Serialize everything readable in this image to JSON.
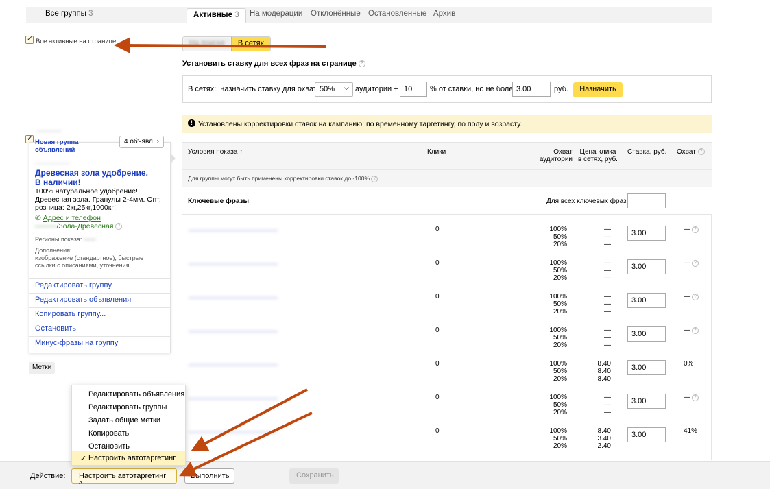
{
  "tabs": {
    "all_groups": "Все группы",
    "all_groups_count": "3",
    "active": "Активные",
    "active_count": "3",
    "moderation": "На модерации",
    "rejected": "Отклонённые",
    "stopped": "Остановленные",
    "archive": "Архив"
  },
  "select_all_label": "Все активные на странице",
  "network_toggle": {
    "search": "На поиске",
    "networks": "В сетях"
  },
  "bid_panel": {
    "title": "Установить ставку для всех фраз на странице",
    "prefix": "В сетях:  назначить ставку для охвата",
    "coverage": "50%",
    "audience_label": "аудитории +",
    "plus_value": "10",
    "limit_label": "% от ставки, но не более",
    "max_value": "3.00",
    "currency": "руб.",
    "assign_button": "Назначить"
  },
  "warning_text": "Установлены корректировки ставок на кампанию: по временному таргетингу, по полу и возрасту.",
  "group_card": {
    "title_line1": "Новая группа",
    "title_line2": "объявлений",
    "ads_count_button": "4 объявл.",
    "ad_title_line1": "Древесная зола удобрение.",
    "ad_title_line2": "В наличии!",
    "ad_text_line1": "100% натуральное удобрение!",
    "ad_text_line2": "Древесная зола. Гранулы 2-4мм. Опт,",
    "ad_text_line3": "розница: 2кг,25кг,1000кг!",
    "address_link": "Адрес и телефон",
    "display_url": "/Зола-Древесная",
    "regions_label": "Регионы показа:",
    "extras_label": "Дополнения:",
    "extras_line1": "изображение (стандартное), быстрые",
    "extras_line2": "ссылки с описаниями, уточнения",
    "actions": [
      "Редактировать группу",
      "Редактировать объявления",
      "Копировать группу...",
      "Остановить",
      "Минус-фразы на группу"
    ]
  },
  "labels_button": "Метки",
  "table": {
    "col_conditions": "Условия показа",
    "col_clicks": "Клики",
    "col_coverage_line1": "Охват",
    "col_coverage_line2": "аудитории",
    "col_cpc_line1": "Цена клика",
    "col_cpc_line2": "в сетях, руб.",
    "col_bid": "Ставка, руб.",
    "col_reach": "Охват",
    "adjust_note": "Для группы могут быть применены корректировки ставок до -100%",
    "keywords_header": "Ключевые фразы",
    "all_keywords_label": "Для всех ключевых фраз:",
    "rows": [
      {
        "clicks": "0",
        "cov": [
          "100%",
          "50%",
          "20%"
        ],
        "cpc": [
          "—",
          "—",
          "—"
        ],
        "bid": "3.00",
        "reach": "—",
        "q": true
      },
      {
        "clicks": "0",
        "cov": [
          "100%",
          "50%",
          "20%"
        ],
        "cpc": [
          "—",
          "—",
          "—"
        ],
        "bid": "3.00",
        "reach": "—",
        "q": true
      },
      {
        "clicks": "0",
        "cov": [
          "100%",
          "50%",
          "20%"
        ],
        "cpc": [
          "—",
          "—",
          "—"
        ],
        "bid": "3.00",
        "reach": "—",
        "q": true
      },
      {
        "clicks": "0",
        "cov": [
          "100%",
          "50%",
          "20%"
        ],
        "cpc": [
          "—",
          "—",
          "—"
        ],
        "bid": "3.00",
        "reach": "—",
        "q": true
      },
      {
        "clicks": "0",
        "cov": [
          "100%",
          "50%",
          "20%"
        ],
        "cpc": [
          "8.40",
          "8.40",
          "8.40"
        ],
        "bid": "3.00",
        "reach": "0%",
        "q": false
      },
      {
        "clicks": "0",
        "cov": [
          "100%",
          "50%",
          "20%"
        ],
        "cpc": [
          "—",
          "—",
          "—"
        ],
        "bid": "3.00",
        "reach": "—",
        "q": true
      },
      {
        "clicks": "0",
        "cov": [
          "100%",
          "50%",
          "20%"
        ],
        "cpc": [
          "8.40",
          "3.40",
          "2.40"
        ],
        "bid": "3.00",
        "reach": "41%",
        "q": false
      }
    ]
  },
  "dropdown": {
    "items": [
      "Редактировать объявления",
      "Редактировать группы",
      "Задать общие метки",
      "Копировать",
      "Остановить",
      "Настроить автотаргетинг"
    ],
    "selected_index": 5
  },
  "bottom": {
    "action_label": "Действие:",
    "action_value": "Настроить автотаргетинг",
    "run_button": "Выполнить",
    "save_button": "Сохранить"
  },
  "colors": {
    "accent_yellow": "#fedb4d",
    "link_blue": "#1a3dc1",
    "annotation_arrow": "#c0480f"
  }
}
